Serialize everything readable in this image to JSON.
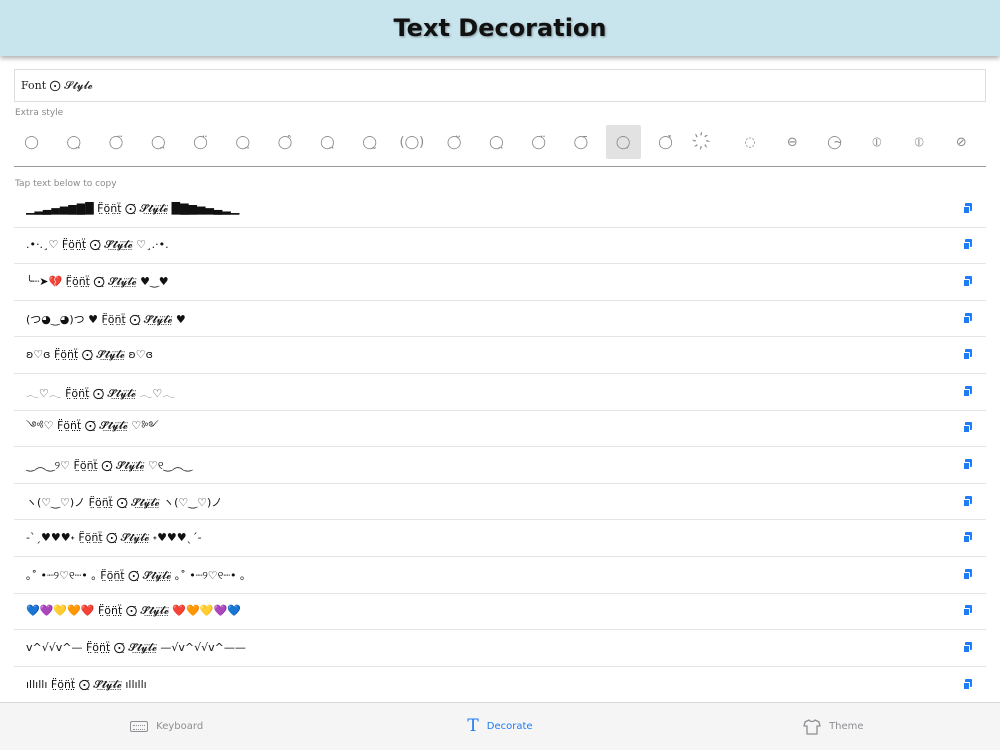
{
  "header": {
    "title": "Text Decoration"
  },
  "input": {
    "value": "Font ⨀ 𝓢𝓽𝔂𝓵𝓮"
  },
  "labels": {
    "extra_style": "Extra style",
    "tap_to_copy": "Tap text below to copy"
  },
  "extra_styles": [
    {
      "glyph": "◯",
      "selected": false
    },
    {
      "glyph": "◯̤",
      "selected": false
    },
    {
      "glyph": "◯̈",
      "selected": false
    },
    {
      "glyph": "◯̤",
      "selected": false
    },
    {
      "glyph": "◯̈",
      "selected": false
    },
    {
      "glyph": "◯̤",
      "selected": false
    },
    {
      "glyph": "◯̂",
      "selected": false
    },
    {
      "glyph": "◯̤",
      "selected": false
    },
    {
      "glyph": "◯̰",
      "selected": false
    },
    {
      "glyph": "(◯)",
      "selected": false
    },
    {
      "glyph": "◯̆",
      "selected": false
    },
    {
      "glyph": "◯̤",
      "selected": false
    },
    {
      "glyph": "◯̈",
      "selected": false
    },
    {
      "glyph": "◯̄",
      "selected": false
    },
    {
      "glyph": "◯̣",
      "selected": true
    },
    {
      "glyph": "◯̽",
      "selected": false
    },
    {
      "glyph": "҉",
      "selected": false
    },
    {
      "glyph": "◌",
      "selected": false
    },
    {
      "glyph": "⊖",
      "selected": false
    },
    {
      "glyph": "◯̴",
      "selected": false
    },
    {
      "glyph": "⦶",
      "selected": false
    },
    {
      "glyph": "⦶",
      "selected": false
    },
    {
      "glyph": "⊘",
      "selected": false
    }
  ],
  "items": [
    "▁▂▃▄▅▆▇█ F̤̈ö̤n̤̈ẗ̤ ⨀̤̈ 𝓢̤̈𝓽̤̈𝔂̤̈𝓵̤̈𝓮̤̈ █▇▆▅▄▃▂▁",
    ".•·.¸♡ F̤̈ö̤n̤̈ẗ̤ ⨀̤̈ 𝓢̤̈𝓽̤̈𝔂̤̈𝓵̤̈𝓮̤̈ ♡¸.·•.",
    "╰┈➤💔 F̤̈ö̤n̤̈ẗ̤ ⨀̤̈ 𝓢̤̈𝓽̤̈𝔂̤̈𝓵̤̈𝓮̤̈ ♥‿♥",
    "(つ◕‿◕)つ ♥ F̤̈ö̤n̤̈ẗ̤ ⨀̤̈ 𝓢̤̈𝓽̤̈𝔂̤̈𝓵̤̈𝓮̤̈ ♥",
    "ʚ♡ɞ F̤̈ö̤n̤̈ẗ̤ ⨀̤̈ 𝓢̤̈𝓽̤̈𝔂̤̈𝓵̤̈𝓮̤̈ ʚ♡ɞ",
    "𓂃♡𓂃 F̤̈ö̤n̤̈ẗ̤ ⨀̤̈ 𝓢̤̈𝓽̤̈𝔂̤̈𝓵̤̈𝓮̤̈ 𓂃♡𓂃",
    "༺♡ F̤̈ö̤n̤̈ẗ̤ ⨀̤̈ 𝓢̤̈𝓽̤̈𝔂̤̈𝓵̤̈𝓮̤̈ ♡༻",
    "‿︵‿୨♡ F̤̈ö̤n̤̈ẗ̤ ⨀̤̈ 𝓢̤̈𝓽̤̈𝔂̤̈𝓵̤̈𝓮̤̈ ♡୧‿︵‿",
    "ヽ(♡‿♡)ノ F̤̈ö̤n̤̈ẗ̤ ⨀̤̈ 𝓢̤̈𝓽̤̈𝔂̤̈𝓵̤̈𝓮̤̈ ヽ(♡‿♡)ノ",
    "-ˋˏ♥♥♥˖ F̤̈ö̤n̤̈ẗ̤ ⨀̤̈ 𝓢̤̈𝓽̤̈𝔂̤̈𝓵̤̈𝓮̤̈ ˖♥♥♥ˎˊ-",
    "｡˚ •┈୨♡୧┈• ｡ F̤̈ö̤n̤̈ẗ̤ ⨀̤̈ 𝓢̤̈𝓽̤̈𝔂̤̈𝓵̤̈𝓮̤̈ ｡˚ •┈୨♡୧┈• ｡",
    "💙💜💛🧡❤️ F̤̈ö̤n̤̈ẗ̤ ⨀̤̈ 𝓢̤̈𝓽̤̈𝔂̤̈𝓵̤̈𝓮̤̈ ❤️🧡💛💜💙",
    "v^√√v^— F̤̈ö̤n̤̈ẗ̤ ⨀̤̈ 𝓢̤̈𝓽̤̈𝔂̤̈𝓵̤̈𝓮̤̈ —√v^√√v^——",
    "ıllıllı F̤̈ö̤n̤̈ẗ̤ ⨀̤̈ 𝓢̤̈𝓽̤̈𝔂̤̈𝓵̤̈𝓮̤̈ ıllıllı"
  ],
  "tabs": [
    {
      "label": "Keyboard",
      "icon": "keyboard-icon",
      "active": false
    },
    {
      "label": "Decorate",
      "icon": "text-t-icon",
      "active": true
    },
    {
      "label": "Theme",
      "icon": "shirt-icon",
      "active": false
    }
  ],
  "colors": {
    "accent": "#1e7cf5",
    "header_bg": "#c8e4ed",
    "selected_cell": "#e2e2e2"
  }
}
